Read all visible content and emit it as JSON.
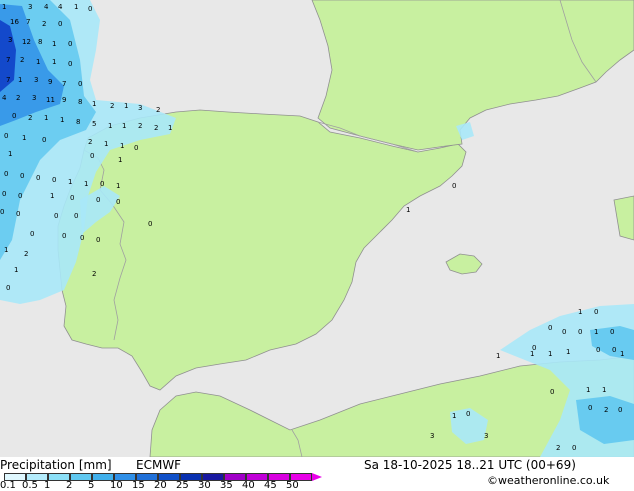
{
  "map": {
    "colors": {
      "sea": "#e8e8e8",
      "land": "#c8f0a0",
      "coast": "#909090",
      "border": "#a0a0a0",
      "precip_light": "#a8e8f8",
      "precip_mid": "#60c8f0",
      "precip_heavy": "#3090e8",
      "precip_extreme": "#1040c8",
      "label_text": "#000000"
    },
    "precip_labels": [
      "1",
      "3",
      "4",
      "4",
      "1",
      "0",
      "16",
      "7",
      "2",
      "0",
      "3",
      "12",
      "8",
      "1",
      "0",
      "7",
      "2",
      "1",
      "1",
      "0",
      "7",
      "1",
      "3",
      "9",
      "7",
      "0",
      "4",
      "2",
      "3",
      "11",
      "9",
      "8",
      "1",
      "2",
      "1",
      "3",
      "2",
      "0",
      "2",
      "1",
      "1",
      "8",
      "5",
      "1",
      "1",
      "2",
      "2",
      "1",
      "0",
      "1",
      "0",
      "2",
      "1",
      "1",
      "0",
      "1",
      "0",
      "1",
      "0",
      "0",
      "0",
      "0",
      "1",
      "1",
      "0",
      "1",
      "0",
      "0",
      "1",
      "0",
      "0",
      "0",
      "0",
      "0",
      "0",
      "0",
      "0",
      "0",
      "0",
      "0",
      "0",
      "1",
      "2",
      "1",
      "2",
      "0",
      "0",
      "1",
      "1",
      "0",
      "1",
      "1",
      "1",
      "0",
      "0",
      "0",
      "0",
      "1",
      "0",
      "1",
      "0",
      "0",
      "1",
      "0",
      "1",
      "1",
      "0",
      "2",
      "0",
      "1",
      "0",
      "3",
      "3",
      "2",
      "0",
      "0",
      "0",
      "0",
      "0",
      "0",
      "0",
      "0"
    ]
  },
  "footer": {
    "title": "Precipitation [mm]",
    "model": "ECMWF",
    "datetime": "Sa 18-10-2025 18..21 UTC (00+69)",
    "credit": "©weatheronline.co.uk",
    "legend_ticks": [
      "0.1",
      "0.5",
      "1",
      "2",
      "5",
      "10",
      "15",
      "20",
      "25",
      "30",
      "35",
      "40",
      "45",
      "50"
    ],
    "legend_colors": [
      "#e0f8ff",
      "#b4ecfc",
      "#8ce0f8",
      "#60c8f0",
      "#40b0ec",
      "#3090e8",
      "#2070d8",
      "#1050c8",
      "#0830b0",
      "#1818a0",
      "#a000c8",
      "#c000d8",
      "#d800e0",
      "#e800e8"
    ]
  }
}
